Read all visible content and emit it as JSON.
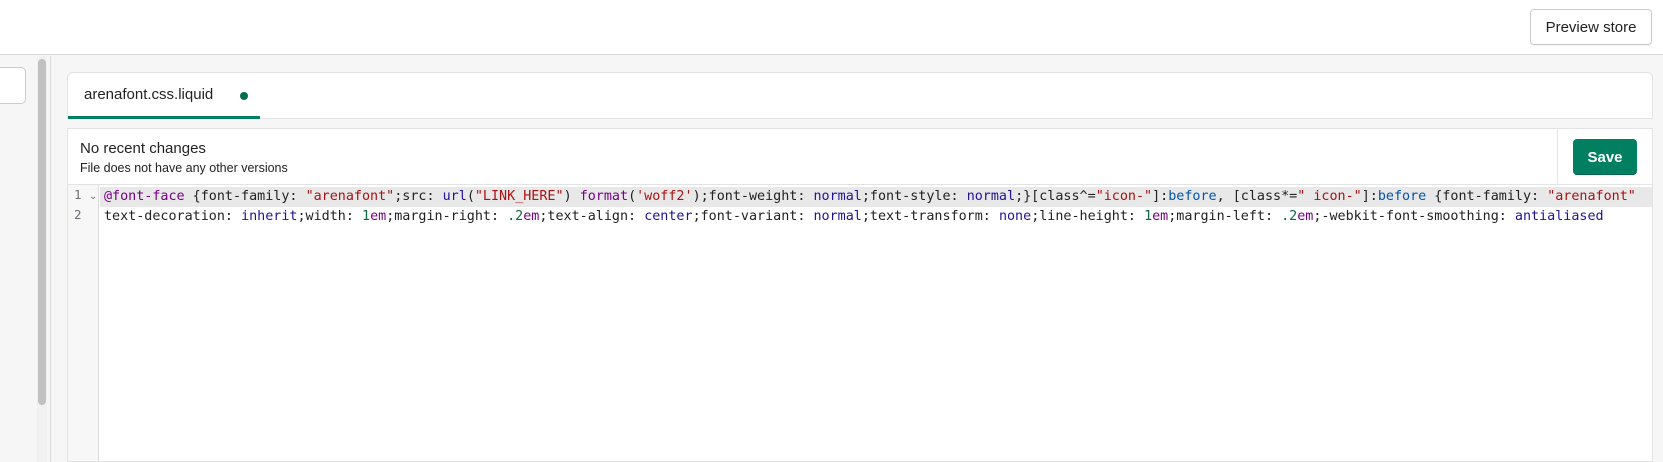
{
  "header": {
    "preview_store_label": "Preview store"
  },
  "editor_tabs": [
    {
      "label": "arenafont.css.liquid",
      "unsaved": true
    }
  ],
  "status": {
    "title": "No recent changes",
    "subtitle": "File does not have any other versions",
    "save_label": "Save"
  },
  "code": {
    "line_numbers": [
      "1",
      "2"
    ],
    "lines": [
      [
        {
          "t": "@font-face",
          "c": "kw"
        },
        {
          "t": " {font-family: ",
          "c": ""
        },
        {
          "t": "\"arenafont\"",
          "c": "str"
        },
        {
          "t": ";src: ",
          "c": ""
        },
        {
          "t": "url",
          "c": "val"
        },
        {
          "t": "(",
          "c": ""
        },
        {
          "t": "\"LINK_HERE\"",
          "c": "str"
        },
        {
          "t": ") ",
          "c": ""
        },
        {
          "t": "format",
          "c": "fn"
        },
        {
          "t": "(",
          "c": ""
        },
        {
          "t": "'woff2'",
          "c": "str"
        },
        {
          "t": ");font-weight: ",
          "c": ""
        },
        {
          "t": "normal",
          "c": "val"
        },
        {
          "t": ";font-style: ",
          "c": ""
        },
        {
          "t": "normal",
          "c": "val"
        },
        {
          "t": ";}[class^=",
          "c": ""
        },
        {
          "t": "\"icon-\"",
          "c": "str"
        },
        {
          "t": "]:",
          "c": ""
        },
        {
          "t": "before",
          "c": "pseudo"
        },
        {
          "t": ", [class*=",
          "c": ""
        },
        {
          "t": "\" icon-\"",
          "c": "str"
        },
        {
          "t": "]:",
          "c": ""
        },
        {
          "t": "before",
          "c": "pseudo"
        },
        {
          "t": " {font-family: ",
          "c": ""
        },
        {
          "t": "\"arenafont\"",
          "c": "str"
        }
      ],
      [
        {
          "t": "text-decoration: ",
          "c": ""
        },
        {
          "t": "inherit",
          "c": "val"
        },
        {
          "t": ";width: ",
          "c": ""
        },
        {
          "t": "1",
          "c": "num"
        },
        {
          "t": "em",
          "c": "unit"
        },
        {
          "t": ";margin-right: ",
          "c": ""
        },
        {
          "t": ".2",
          "c": "num"
        },
        {
          "t": "em",
          "c": "unit"
        },
        {
          "t": ";text-align: ",
          "c": ""
        },
        {
          "t": "center",
          "c": "val"
        },
        {
          "t": ";font-variant: ",
          "c": ""
        },
        {
          "t": "normal",
          "c": "val"
        },
        {
          "t": ";text-transform: ",
          "c": ""
        },
        {
          "t": "none",
          "c": "val"
        },
        {
          "t": ";line-height: ",
          "c": ""
        },
        {
          "t": "1",
          "c": "num"
        },
        {
          "t": "em",
          "c": "unit"
        },
        {
          "t": ";margin-left: ",
          "c": ""
        },
        {
          "t": ".2",
          "c": "num"
        },
        {
          "t": "em",
          "c": "unit"
        },
        {
          "t": ";-webkit-font-smoothing: ",
          "c": ""
        },
        {
          "t": "antialiased",
          "c": "val"
        }
      ]
    ]
  },
  "colors": {
    "accent": "#008060",
    "unsaved_dot": "#00704a",
    "page_bg": "#f6f6f7"
  },
  "icons": [
    "fold-chevron-icon",
    "unsaved-dot-icon"
  ]
}
